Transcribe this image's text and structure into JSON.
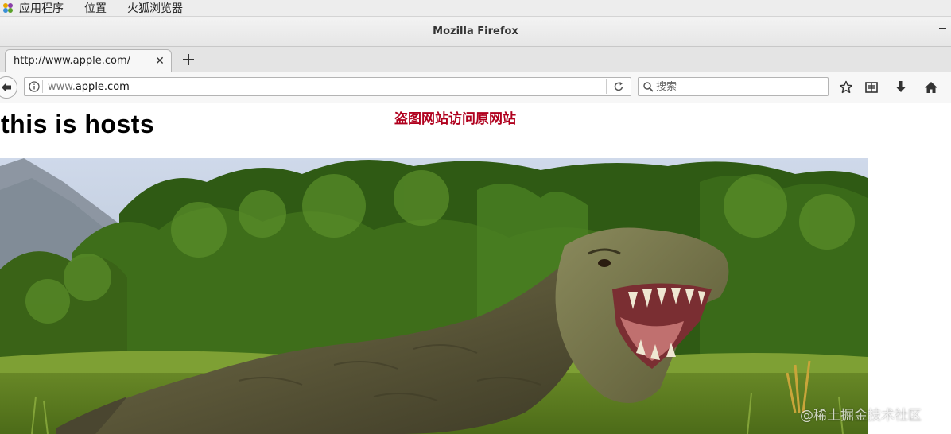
{
  "topbar": {
    "menus": [
      "应用程序",
      "位置",
      "火狐浏览器"
    ]
  },
  "window": {
    "title": "Mozilla Firefox"
  },
  "tabs": [
    {
      "label": "http://www.apple.com/",
      "active": true
    }
  ],
  "navbar": {
    "url_prefix": "www.",
    "url_domain": "apple.com",
    "search_placeholder": "搜索"
  },
  "content": {
    "heading": "this is hosts",
    "overlay_label": "盗图网站访问原网站",
    "image_subject": "tyrannosaurus-rex-in-jungle"
  },
  "watermark": "@稀土掘金技术社区",
  "colors": {
    "overlay_label": "#b0001e",
    "jungle_green": "#3f6a1c",
    "sky": "#c7d3e6"
  }
}
